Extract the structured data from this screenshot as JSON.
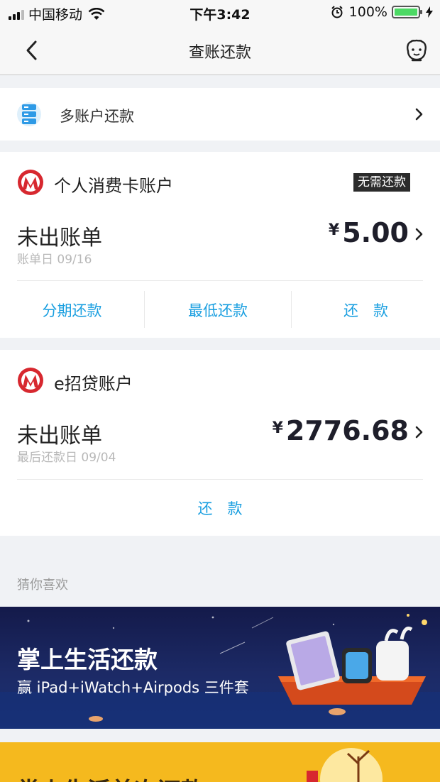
{
  "status_bar": {
    "carrier": "中国移动",
    "time": "下午3:42",
    "battery": "100%"
  },
  "nav": {
    "title": "查账还款"
  },
  "multi_account": {
    "label": "多账户还款"
  },
  "accounts": [
    {
      "name": "个人消费卡账户",
      "badge": "无需还款",
      "bill_title": "未出账单",
      "bill_date": "账单日 09/16",
      "currency": "¥",
      "amount": "5.00",
      "actions": [
        "分期还款",
        "最低还款",
        "还　款"
      ]
    },
    {
      "name": "e招贷账户",
      "bill_title": "未出账单",
      "bill_date": "最后还款日 09/04",
      "currency": "¥",
      "amount": "2776.68",
      "actions": [
        "还　款"
      ]
    }
  ],
  "recommend": {
    "label": "猜你喜欢",
    "banner1_title": "掌上生活还款",
    "banner1_subtitle": "赢 iPad+iWatch+Airpods 三件套",
    "banner2_title": "掌上生活首次还款"
  },
  "colors": {
    "accent": "#1a9fe0",
    "brand_red": "#d7282f",
    "battery": "#4cd964"
  }
}
